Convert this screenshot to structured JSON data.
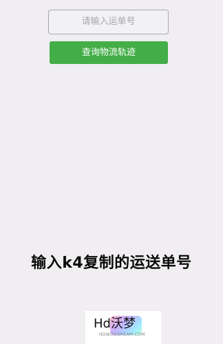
{
  "tracking_input": {
    "value": "",
    "placeholder": "请输入运单号"
  },
  "query_button": {
    "label": "查询物流轨迹"
  },
  "caption": {
    "text": "输入k4复制的运送单号"
  },
  "watermark": {
    "title": "Hd沃梦",
    "subtitle": "HDWOODREAM.COM"
  },
  "colors": {
    "screen_background": "#f0eef1",
    "button_background": "#43ae47",
    "button_text": "#ffffff",
    "input_border": "#a7a7ab",
    "placeholder_text": "#a9a9ad",
    "caption_text": "#0b0b0b"
  }
}
